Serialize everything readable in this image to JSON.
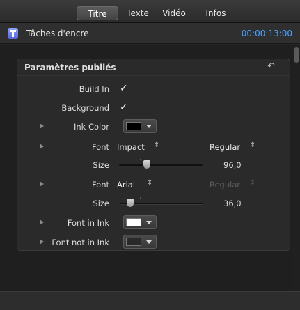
{
  "tabs": [
    {
      "label": "Titre",
      "active": true
    },
    {
      "label": "Texte",
      "active": false
    },
    {
      "label": "Vidéo",
      "active": false
    },
    {
      "label": "Infos",
      "active": false
    }
  ],
  "header": {
    "icon": "title-icon",
    "title": "Tâches d'encre",
    "timecode": "00:00:13:00"
  },
  "panel": {
    "title": "Paramètres publiés",
    "reset_icon": "reset-arrow-icon"
  },
  "params": {
    "build_in": {
      "label": "Build In",
      "checked": true,
      "mark": "✓"
    },
    "background": {
      "label": "Background",
      "checked": true,
      "mark": "✓"
    },
    "ink_color": {
      "label": "Ink Color",
      "color": "#000000"
    },
    "font1": {
      "label": "Font",
      "name": "Impact",
      "style": "Regular"
    },
    "size1": {
      "label": "Size",
      "value": "96,0",
      "level": 0.33
    },
    "font2": {
      "label": "Font",
      "name": "Arial",
      "style": "Regular",
      "style_disabled": true
    },
    "size2": {
      "label": "Size",
      "value": "36,0",
      "level": 0.13
    },
    "font_in_ink": {
      "label": "Font in Ink",
      "color": "#ffffff"
    },
    "font_not_in_ink": {
      "label": "Font not in Ink",
      "color": "#2a2a2a"
    }
  },
  "glyphs": {
    "updown": "⇕",
    "reset": "↶"
  },
  "colors": {
    "timecode": "#4aa3ff",
    "background": "#262626"
  }
}
